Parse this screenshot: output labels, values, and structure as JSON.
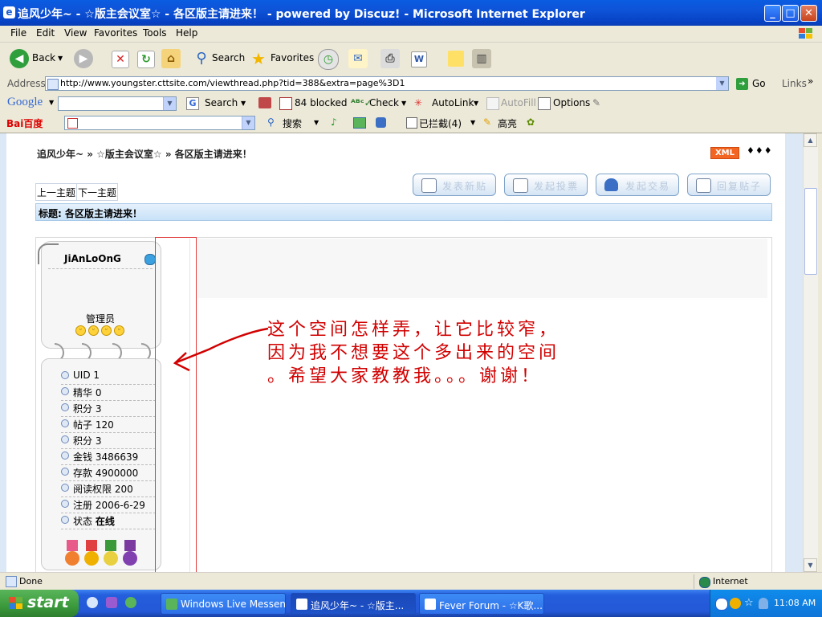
{
  "window": {
    "title": "追风少年~ - ☆版主会议室☆ - 各区版主请进来！ - powered by Discuz! - Microsoft Internet Explorer",
    "minimize": "_",
    "maximize": "□",
    "close": "✕"
  },
  "menu": [
    "File",
    "Edit",
    "View",
    "Favorites",
    "Tools",
    "Help"
  ],
  "toolbar": {
    "back": "Back",
    "search": "Search",
    "favorites": "Favorites"
  },
  "address": {
    "label": "Address",
    "url": "http://www.youngster.cttsite.com/viewthread.php?tid=388&extra=page%3D1",
    "go": "Go",
    "links": "Links"
  },
  "google_bar": {
    "logo": "Google",
    "search": "Search",
    "blocked": "84 blocked",
    "check": "Check",
    "autolink": "AutoLink",
    "autofill": "AutoFill",
    "options": "Options"
  },
  "baidu_bar": {
    "logo": "Bai百度",
    "search": "搜索",
    "blocked": "已拦截(4)",
    "highlight": "高亮"
  },
  "page": {
    "breadcrumb": "追风少年~ » ☆版主会议室☆ » 各区版主请进来！",
    "xml_badge": "XML",
    "rss_dots": "♦♦♦",
    "prev_thread": "上一主题",
    "next_thread": "下一主题",
    "actions": [
      "发表新贴",
      "发起投票",
      "发起交易",
      "回复贴子"
    ],
    "subject": "标题: 各区版主请进来！"
  },
  "user": {
    "name": "JiAnLoOnG",
    "group": "管理员",
    "stats": [
      {
        "label": "UID 1"
      },
      {
        "label": "精华 0"
      },
      {
        "label": "积分 3"
      },
      {
        "label": "帖子 120"
      },
      {
        "label": "积分 3"
      },
      {
        "label": "金钱 3486639"
      },
      {
        "label": "存款 4900000"
      },
      {
        "label": "阅读权限 200"
      },
      {
        "label": "注册 2006-6-29"
      },
      {
        "label": "状态",
        "value": "在线"
      }
    ]
  },
  "annotation": {
    "line1": "这个空间怎样弄，让它比较窄，",
    "line2": "因为我不想要这个多出来的空间",
    "line3": "。希望大家教教我。。。谢谢！"
  },
  "status": {
    "text": "Done",
    "zone": "Internet"
  },
  "taskbar": {
    "start": "start",
    "items": [
      "Windows Live Messen...",
      "追风少年~ - ☆版主...",
      "Fever Forum - ☆K歌..."
    ],
    "clock": "11:08 AM"
  },
  "colors": {
    "annotation": "#d10000",
    "xml_badge": "#F26522",
    "title_bar": "#0A5CE0"
  }
}
